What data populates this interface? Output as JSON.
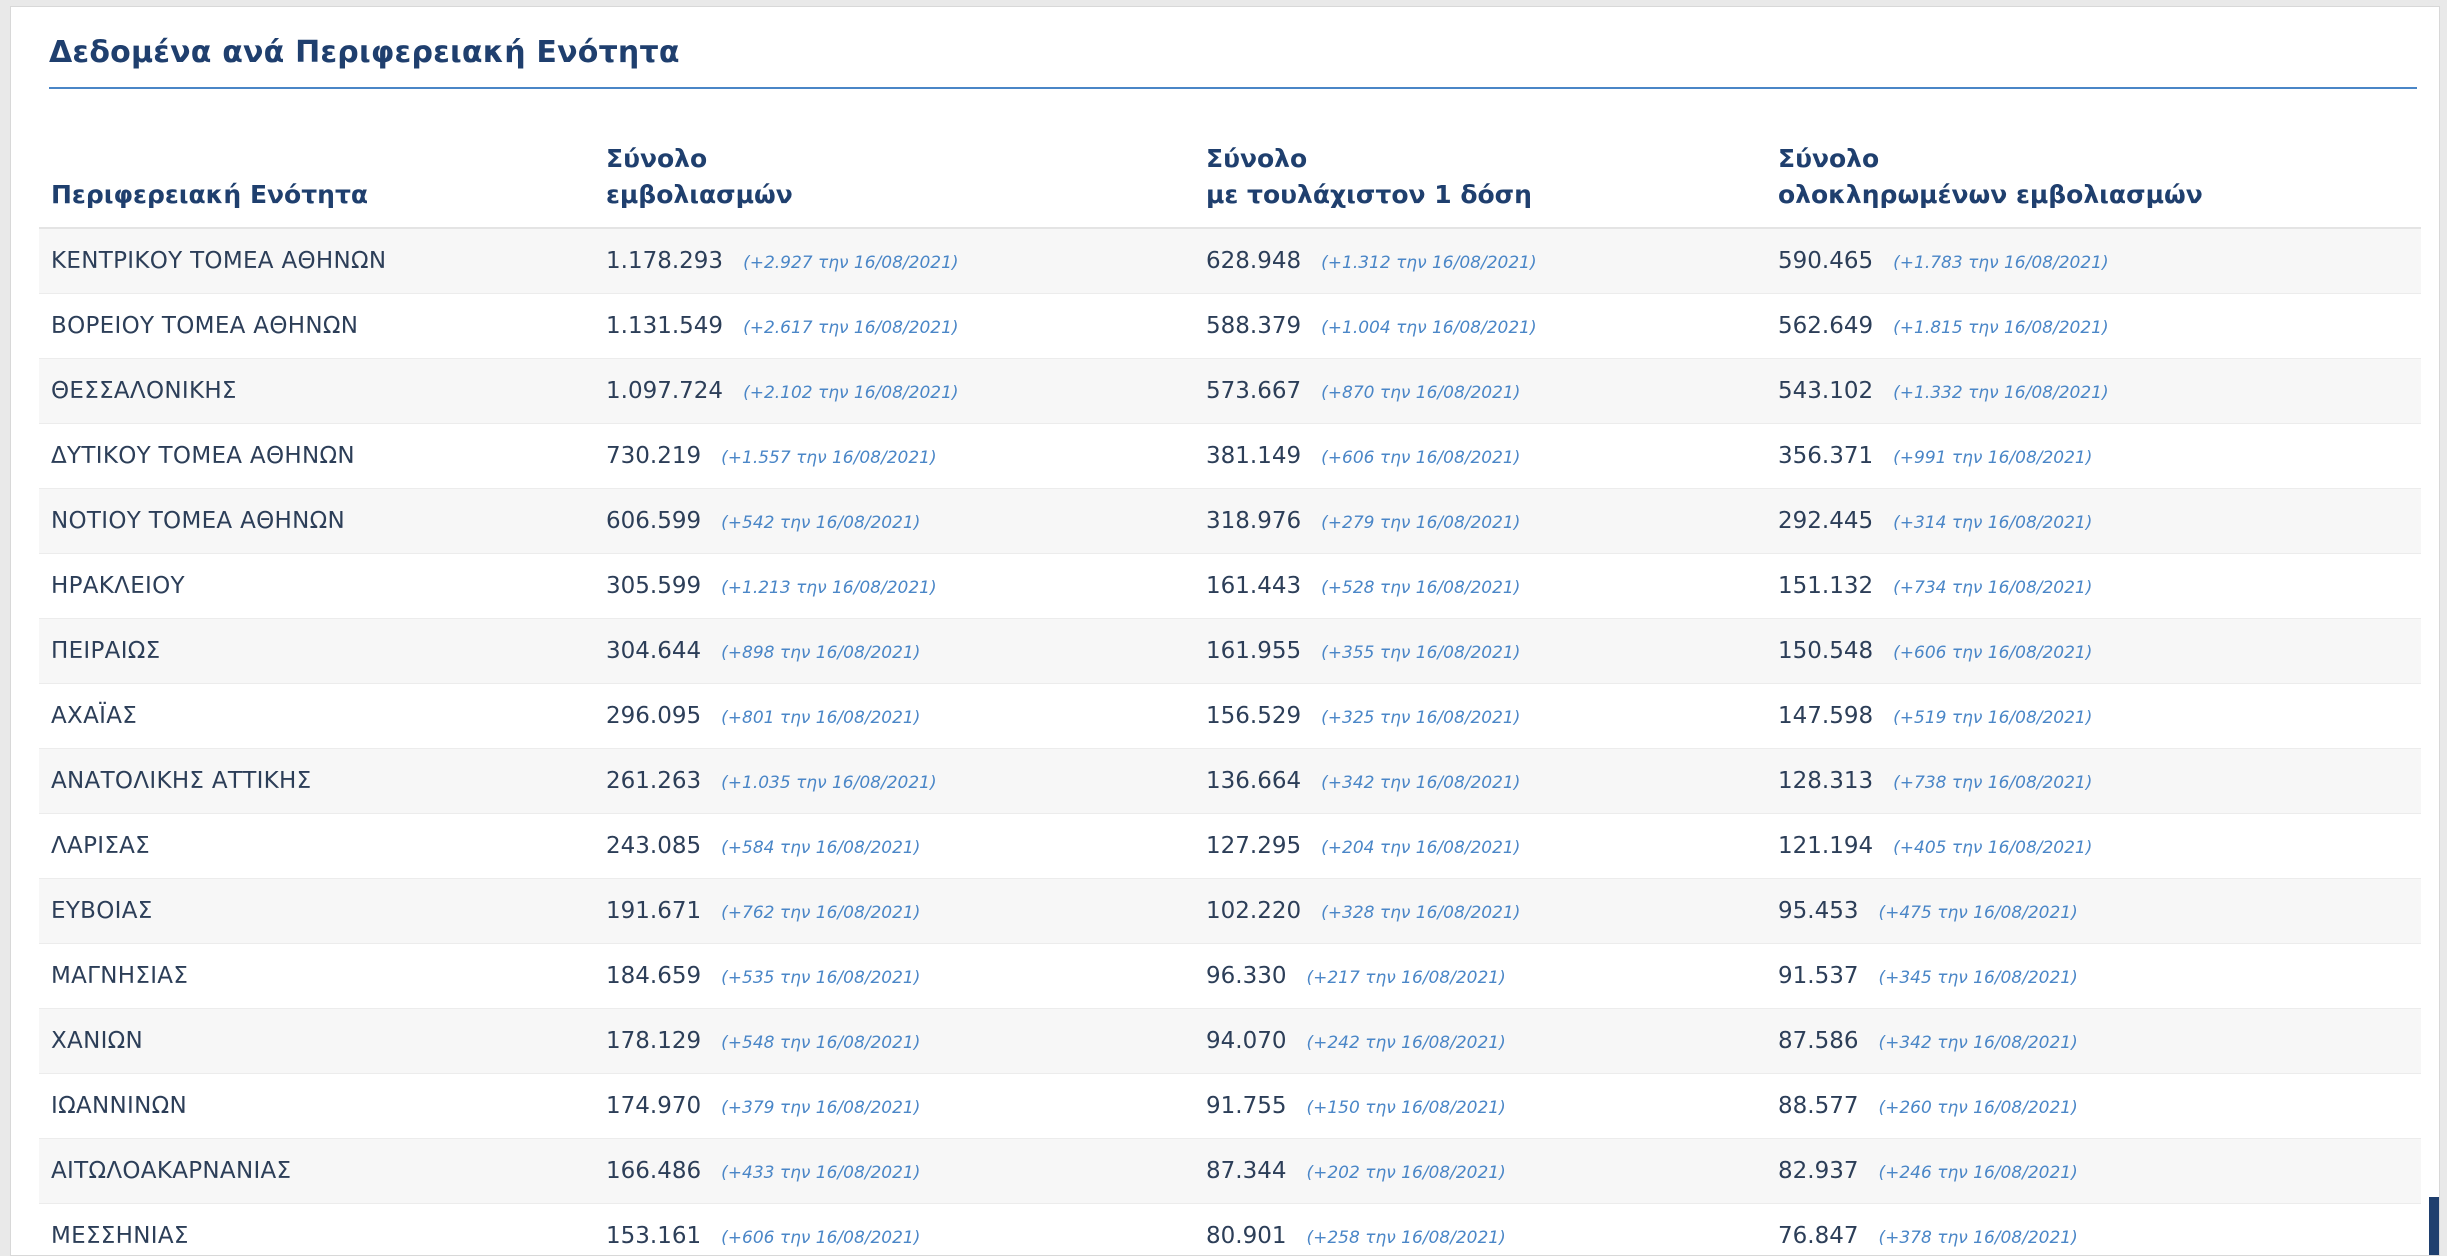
{
  "title": "Δεδομένα ανά Περιφερειακή Ενότητα",
  "headers": {
    "region": "Περιφερειακή Ενότητα",
    "total_line1": "Σύνολο",
    "total_line2": "εμβολιασμών",
    "first_dose_line1": "Σύνολο",
    "first_dose_line2": "με τουλάχιστον 1 δόση",
    "completed_line1": "Σύνολο",
    "completed_line2": "ολοκληρωμένων εμβολιασμών"
  },
  "rows": [
    {
      "region": "ΚΕΝΤΡΙΚΟΥ ΤΟΜΕΑ ΑΘΗΝΩΝ",
      "total": "1.178.293",
      "total_delta": "(+2.927 την 16/08/2021)",
      "first": "628.948",
      "first_delta": "(+1.312 την 16/08/2021)",
      "completed": "590.465",
      "completed_delta": "(+1.783 την 16/08/2021)"
    },
    {
      "region": "ΒΟΡΕΙΟΥ ΤΟΜΕΑ ΑΘΗΝΩΝ",
      "total": "1.131.549",
      "total_delta": "(+2.617 την 16/08/2021)",
      "first": "588.379",
      "first_delta": "(+1.004 την 16/08/2021)",
      "completed": "562.649",
      "completed_delta": "(+1.815 την 16/08/2021)"
    },
    {
      "region": "ΘΕΣΣΑΛΟΝΙΚΗΣ",
      "total": "1.097.724",
      "total_delta": "(+2.102 την 16/08/2021)",
      "first": "573.667",
      "first_delta": "(+870 την 16/08/2021)",
      "completed": "543.102",
      "completed_delta": "(+1.332 την 16/08/2021)"
    },
    {
      "region": "ΔΥΤΙΚΟΥ ΤΟΜΕΑ ΑΘΗΝΩΝ",
      "total": "730.219",
      "total_delta": "(+1.557 την 16/08/2021)",
      "first": "381.149",
      "first_delta": "(+606 την 16/08/2021)",
      "completed": "356.371",
      "completed_delta": "(+991 την 16/08/2021)"
    },
    {
      "region": "ΝΟΤΙΟΥ ΤΟΜΕΑ ΑΘΗΝΩΝ",
      "total": "606.599",
      "total_delta": "(+542 την 16/08/2021)",
      "first": "318.976",
      "first_delta": "(+279 την 16/08/2021)",
      "completed": "292.445",
      "completed_delta": "(+314 την 16/08/2021)"
    },
    {
      "region": "ΗΡΑΚΛΕΙΟΥ",
      "total": "305.599",
      "total_delta": "(+1.213 την 16/08/2021)",
      "first": "161.443",
      "first_delta": "(+528 την 16/08/2021)",
      "completed": "151.132",
      "completed_delta": "(+734 την 16/08/2021)"
    },
    {
      "region": "ΠΕΙΡΑΙΩΣ",
      "total": "304.644",
      "total_delta": "(+898 την 16/08/2021)",
      "first": "161.955",
      "first_delta": "(+355 την 16/08/2021)",
      "completed": "150.548",
      "completed_delta": "(+606 την 16/08/2021)"
    },
    {
      "region": "ΑΧΑΪΑΣ",
      "total": "296.095",
      "total_delta": "(+801 την 16/08/2021)",
      "first": "156.529",
      "first_delta": "(+325 την 16/08/2021)",
      "completed": "147.598",
      "completed_delta": "(+519 την 16/08/2021)"
    },
    {
      "region": "ΑΝΑΤΟΛΙΚΗΣ ΑΤΤΙΚΗΣ",
      "total": "261.263",
      "total_delta": "(+1.035 την 16/08/2021)",
      "first": "136.664",
      "first_delta": "(+342 την 16/08/2021)",
      "completed": "128.313",
      "completed_delta": "(+738 την 16/08/2021)"
    },
    {
      "region": "ΛΑΡΙΣΑΣ",
      "total": "243.085",
      "total_delta": "(+584 την 16/08/2021)",
      "first": "127.295",
      "first_delta": "(+204 την 16/08/2021)",
      "completed": "121.194",
      "completed_delta": "(+405 την 16/08/2021)"
    },
    {
      "region": "ΕΥΒΟΙΑΣ",
      "total": "191.671",
      "total_delta": "(+762 την 16/08/2021)",
      "first": "102.220",
      "first_delta": "(+328 την 16/08/2021)",
      "completed": "95.453",
      "completed_delta": "(+475 την 16/08/2021)"
    },
    {
      "region": "ΜΑΓΝΗΣΙΑΣ",
      "total": "184.659",
      "total_delta": "(+535 την 16/08/2021)",
      "first": "96.330",
      "first_delta": "(+217 την 16/08/2021)",
      "completed": "91.537",
      "completed_delta": "(+345 την 16/08/2021)"
    },
    {
      "region": "ΧΑΝΙΩΝ",
      "total": "178.129",
      "total_delta": "(+548 την 16/08/2021)",
      "first": "94.070",
      "first_delta": "(+242 την 16/08/2021)",
      "completed": "87.586",
      "completed_delta": "(+342 την 16/08/2021)"
    },
    {
      "region": "ΙΩΑΝΝΙΝΩΝ",
      "total": "174.970",
      "total_delta": "(+379 την 16/08/2021)",
      "first": "91.755",
      "first_delta": "(+150 την 16/08/2021)",
      "completed": "88.577",
      "completed_delta": "(+260 την 16/08/2021)"
    },
    {
      "region": "ΑΙΤΩΛΟΑΚΑΡΝΑΝΙΑΣ",
      "total": "166.486",
      "total_delta": "(+433 την 16/08/2021)",
      "first": "87.344",
      "first_delta": "(+202 την 16/08/2021)",
      "completed": "82.937",
      "completed_delta": "(+246 την 16/08/2021)"
    },
    {
      "region": "ΜΕΣΣΗΝΙΑΣ",
      "total": "153.161",
      "total_delta": "(+606 την 16/08/2021)",
      "first": "80.901",
      "first_delta": "(+258 την 16/08/2021)",
      "completed": "76.847",
      "completed_delta": "(+378 την 16/08/2021)"
    }
  ]
}
